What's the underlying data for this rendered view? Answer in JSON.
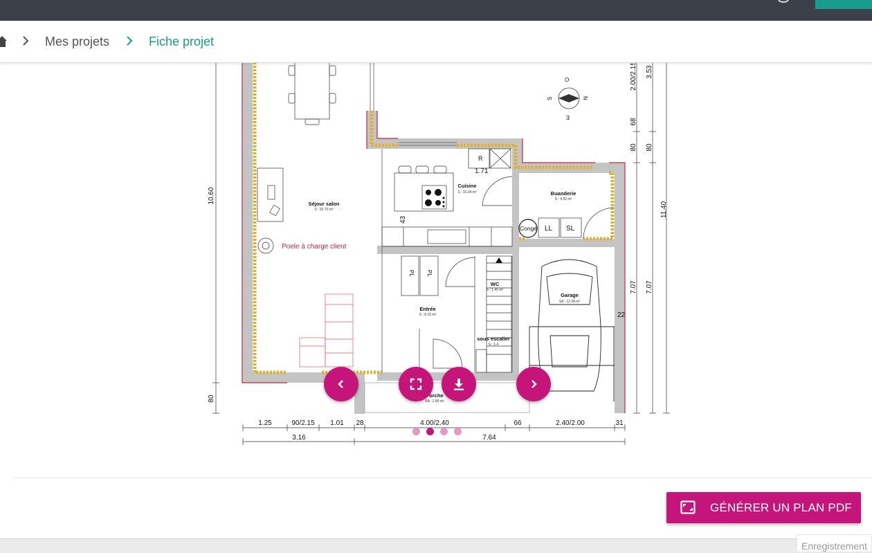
{
  "breadcrumb": {
    "items": [
      "Mes projets",
      "Fiche projet"
    ]
  },
  "plan": {
    "rooms": [
      {
        "name": "Séjour salon",
        "area": "S : 33.70 m²"
      },
      {
        "name": "Cuisine",
        "area": "S : 10.34 m²"
      },
      {
        "name": "Buanderie",
        "area": "S : 4.52 m²"
      },
      {
        "name": "Entrée",
        "area": "S : 8.15 m²"
      },
      {
        "name": "WC",
        "area": "S : 1.45 m²"
      },
      {
        "name": "Garage",
        "area": "SA : 12.38 m²"
      },
      {
        "name": "sous escalier",
        "area": "S : 1.4"
      },
      {
        "name": "Porche",
        "area": "SA : 2.80 m²"
      }
    ],
    "fixtures": {
      "poele": "Poele à charge client",
      "fridge": "R",
      "conge": "Congé",
      "ll": "LL",
      "sl": "SL",
      "pl1": "PL",
      "pl2": "PL",
      "dim_171": "1.71",
      "dim_43": "43",
      "dim_22": "22"
    },
    "compass": {
      "n": "N",
      "s": "S",
      "e": "E",
      "o": "O"
    },
    "dims": {
      "left_height": "10.60",
      "left_bottom": "80",
      "right_v1": [
        "2.00/2.15",
        "68",
        "80",
        "7.07"
      ],
      "right_v2": [
        "3.53",
        "80",
        "11.40",
        "7.07"
      ],
      "bottom_row1": [
        "1.25",
        "90/2.15",
        "1.01",
        "28",
        "4.00/2.40",
        "66",
        "2.40/2.00",
        "31"
      ],
      "bottom_row2": [
        "3.16",
        "7.64"
      ]
    },
    "carousel": {
      "pages": 4,
      "active": 2
    }
  },
  "actions": {
    "pdf_label": "GÉNÉRER UN PLAN PDF"
  },
  "status": {
    "text": "Enregistrement"
  },
  "colors": {
    "accent": "#c5157a",
    "teal": "#1a9c8c",
    "topbar": "#3b4049"
  }
}
